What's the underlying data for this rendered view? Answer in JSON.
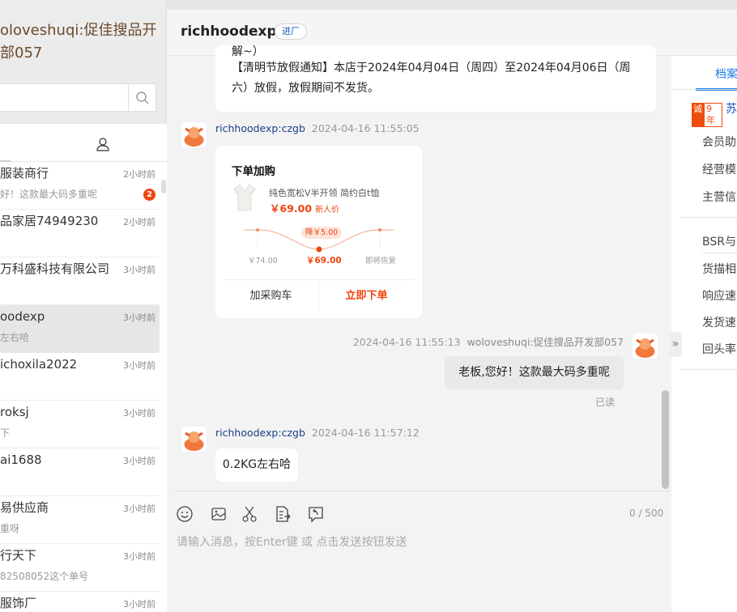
{
  "account": {
    "name_line1": "oloveshuqi:促佳搜品开",
    "name_line2": "部057"
  },
  "search": {
    "placeholder": ""
  },
  "contacts": [
    {
      "name": "服装商行",
      "time": "2小时前",
      "preview": "好！这款最大码多重呢",
      "badge": "2"
    },
    {
      "name": "品家居74949230",
      "time": "2小时前",
      "preview": ""
    },
    {
      "name": "万科盛科技有限公司",
      "time": "3小时前",
      "preview": ""
    },
    {
      "name": "oodexp",
      "time": "3小时前",
      "preview": "左右哈",
      "selected": true
    },
    {
      "name": "ichoxila2022",
      "time": "3小时前",
      "preview": ""
    },
    {
      "name": "roksj",
      "time": "3小时前",
      "preview": "下"
    },
    {
      "name": "ai1688",
      "time": "3小时前",
      "preview": ""
    },
    {
      "name": "易供应商",
      "time": "3小时前",
      "preview": "重呀"
    },
    {
      "name": "行天下",
      "time": "3小时前",
      "preview": "82508052这个单号"
    },
    {
      "name": "服饰厂",
      "time": "3小时前",
      "preview": ""
    }
  ],
  "chat": {
    "title": "richhoodexp",
    "tag": "进厂",
    "notice_partial": "解~）",
    "notice": "【清明节放假通知】本店于2024年04月04日（周四）至2024年04月06日（周六）放假，放假期间不发货。",
    "msg1": {
      "sender": "richhoodexp:czgb",
      "time": "2024-04-16 11:55:05"
    },
    "card": {
      "title": "下单加购",
      "product": "纯色宽松V半开领 简约白t恤",
      "price": "￥69.00",
      "price_note": "新人价",
      "drop": "降￥5.00",
      "old_price": "￥74.00",
      "new_price": "￥69.00",
      "restore": "即将恢复",
      "add_cart": "加采购车",
      "buy_now": "立即下单"
    },
    "msg2": {
      "time": "2024-04-16 11:55:13",
      "sender": "woloveshuqi:促佳搜品开发部057",
      "text": "老板,您好！这款最大码多重呢",
      "status": "已读"
    },
    "msg3": {
      "sender": "richhoodexp:czgb",
      "time": "2024-04-16 11:57:12",
      "text": "0.2KG左右哈"
    }
  },
  "composer": {
    "count": "0 / 500",
    "placeholder": "请输入消息，按Enter键 或 点击发送按钮发送"
  },
  "right_panel": {
    "tab": "档案",
    "badge_a": "诚",
    "badge_b": "9年",
    "company": "苏",
    "rows": [
      "会员助",
      "经营模",
      "主营信"
    ],
    "rows2": [
      "BSR与",
      "货描相",
      "响应速",
      "发货速",
      "回头率"
    ]
  },
  "colors": {
    "accent": "#f0440f",
    "link": "#1a7ee8"
  }
}
